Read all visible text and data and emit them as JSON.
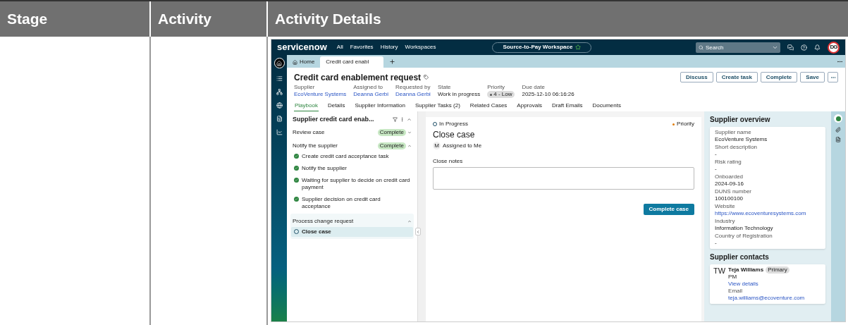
{
  "columns": [
    "Stage",
    "Activity",
    "Activity Details"
  ],
  "screenshot": {
    "logo": "servicenow",
    "nav": [
      "All",
      "Favorites",
      "History",
      "Workspaces"
    ],
    "workspace": "Source-to-Pay Workspace",
    "search": {
      "placeholder": "Search"
    },
    "avatar": "DG",
    "tabs": [
      {
        "label": "Home",
        "kind": "home",
        "selected": false
      },
      {
        "label": "Credit card enabl",
        "kind": "record",
        "selected": true
      }
    ],
    "record": {
      "title": "Credit card enablement request",
      "actions": [
        "Discuss",
        "Create task",
        "Complete",
        "Save"
      ],
      "fields": [
        {
          "label": "Supplier",
          "value": "EcoVenture Systems",
          "kind": "link"
        },
        {
          "label": "Assigned to",
          "value": "Deanna Gerbi",
          "kind": "link"
        },
        {
          "label": "Requested by",
          "value": "Deanna Gerbi",
          "kind": "link"
        },
        {
          "label": "State",
          "value": "Work in progress",
          "kind": "text"
        },
        {
          "label": "Priority",
          "value": "4 - Low",
          "kind": "badge"
        },
        {
          "label": "Due date",
          "value": "2025-12-10 06:16:26",
          "kind": "text"
        }
      ]
    },
    "record_tabs": [
      {
        "label": "Playbook",
        "selected": true
      },
      {
        "label": "Details",
        "selected": false
      },
      {
        "label": "Supplier Information",
        "selected": false
      },
      {
        "label": "Supplier Tasks (2)",
        "selected": false
      },
      {
        "label": "Related Cases",
        "selected": false
      },
      {
        "label": "Approvals",
        "selected": false
      },
      {
        "label": "Draft Emails",
        "selected": false
      },
      {
        "label": "Documents",
        "selected": false
      }
    ],
    "playbook": {
      "title": "Supplier credit card enab...",
      "stages": [
        {
          "label": "Review case",
          "status": "Complete",
          "expanded": false
        },
        {
          "label": "Notify the supplier",
          "status": "Complete",
          "expanded": true,
          "children": [
            {
              "label": "Create credit card acceptance task",
              "done": true,
              "selected": false
            },
            {
              "label": "Notify the supplier",
              "done": true,
              "selected": false
            },
            {
              "label": "Waiting for supplier to decide on credit card payment",
              "done": true,
              "selected": false
            },
            {
              "label": "Supplier decision on credit card acceptance",
              "done": true,
              "selected": false
            }
          ]
        },
        {
          "label": "Process change request",
          "expanded": true,
          "children": [
            {
              "label": "Close case",
              "done": false,
              "selected": true
            }
          ]
        }
      ]
    },
    "task": {
      "state": "In Progress",
      "priority": "Priority",
      "title": "Close case",
      "assignee_initial": "M",
      "assignee": "Assigned to Me",
      "notes_label": "Close notes",
      "action": "Complete case"
    },
    "overview": {
      "title": "Supplier overview",
      "fields": [
        {
          "label": "Supplier name",
          "value": "EcoVenture Systems",
          "kind": "text"
        },
        {
          "label": "Short description",
          "value": "-",
          "kind": "text"
        },
        {
          "label": "Risk rating",
          "value": "-",
          "kind": "text"
        },
        {
          "label": "Onboarded",
          "value": "2024-09-16",
          "kind": "text"
        },
        {
          "label": "DUNS number",
          "value": "100100100",
          "kind": "text"
        },
        {
          "label": "Website",
          "value": "https://www.ecoventuresystems.com",
          "kind": "link"
        },
        {
          "label": "Industry",
          "value": "Information Technology",
          "kind": "text"
        },
        {
          "label": "Country of Registration",
          "value": "-",
          "kind": "text"
        }
      ]
    },
    "contacts": {
      "title": "Supplier contacts",
      "items": [
        {
          "initials": "TW",
          "name": "Teja Williams",
          "badge": "Primary",
          "role": "PM",
          "details_link": "View details",
          "email_label": "Email",
          "email": "teja.williams@ecoventure.com"
        }
      ]
    }
  }
}
